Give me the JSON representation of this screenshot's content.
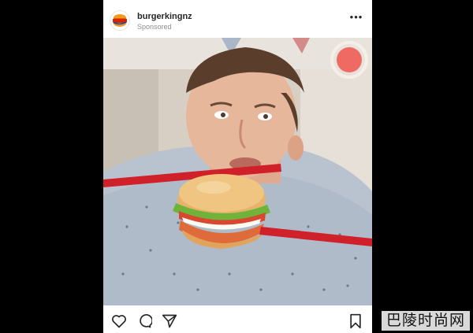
{
  "post": {
    "username": "burgerkingnz",
    "sponsored_label": "Sponsored",
    "more_label": "•••",
    "avatar_icon": "burger-king-logo-icon"
  },
  "actions": {
    "like_icon": "heart-icon",
    "comment_icon": "comment-icon",
    "share_icon": "paper-plane-icon",
    "save_icon": "bookmark-icon"
  },
  "watermark": {
    "text": "巴陵时尚网"
  },
  "colors": {
    "background": "#000000",
    "card": "#ffffff",
    "chopstick_red": "#d0202a",
    "brand_orange": "#f29a1e",
    "brand_blue": "#1d4fa0"
  }
}
